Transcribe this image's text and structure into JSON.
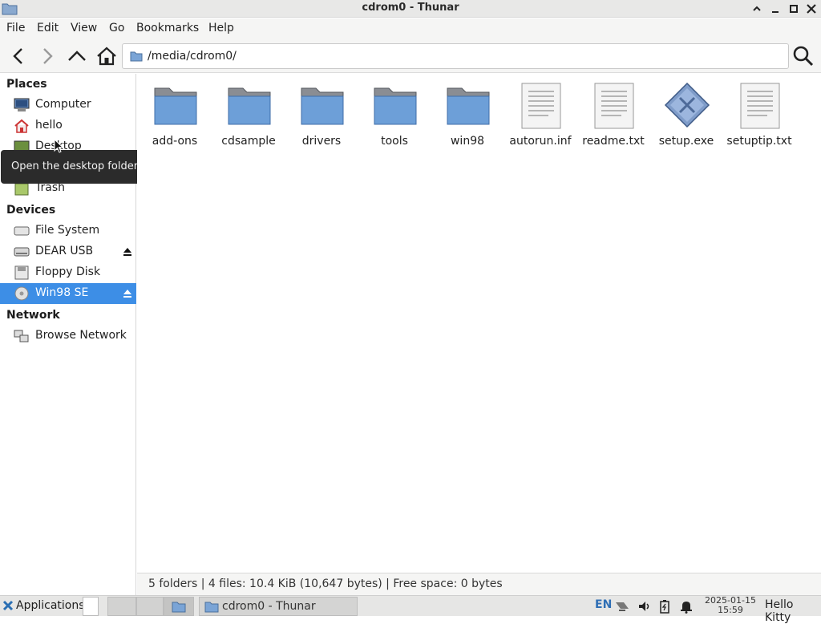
{
  "window": {
    "title": "cdrom0 - Thunar"
  },
  "menubar": {
    "items": [
      "File",
      "Edit",
      "View",
      "Go",
      "Bookmarks",
      "Help"
    ]
  },
  "toolbar": {
    "location": "/media/cdrom0/"
  },
  "sidebar": {
    "places_header": "Places",
    "places": [
      {
        "label": "Computer",
        "icon": "computer-icon"
      },
      {
        "label": "hello",
        "icon": "home-icon"
      },
      {
        "label": "Desktop",
        "icon": "desktop-icon"
      },
      {
        "label": "Trash",
        "icon": "trash-icon"
      }
    ],
    "devices_header": "Devices",
    "devices": [
      {
        "label": "File System",
        "icon": "drive-icon"
      },
      {
        "label": "DEAR USB",
        "icon": "usb-drive-icon"
      },
      {
        "label": "Floppy Disk",
        "icon": "floppy-icon"
      },
      {
        "label": "Win98 SE",
        "icon": "cdrom-icon"
      }
    ],
    "network_header": "Network",
    "network": [
      {
        "label": "Browse Network",
        "icon": "network-icon"
      }
    ]
  },
  "tooltip": "Open the desktop folder",
  "files": [
    {
      "name": "add-ons",
      "type": "folder"
    },
    {
      "name": "cdsample",
      "type": "folder"
    },
    {
      "name": "drivers",
      "type": "folder"
    },
    {
      "name": "tools",
      "type": "folder"
    },
    {
      "name": "win98",
      "type": "folder"
    },
    {
      "name": "autorun.inf",
      "type": "text"
    },
    {
      "name": "readme.txt",
      "type": "text"
    },
    {
      "name": "setup.exe",
      "type": "exe"
    },
    {
      "name": "setuptip.txt",
      "type": "text"
    }
  ],
  "statusbar": {
    "text": "5 folders  |  4 files: 10.4 KiB (10,647 bytes)  |  Free space: 0 bytes"
  },
  "taskbar": {
    "applications": "Applications",
    "window_label": "cdrom0 - Thunar",
    "lang": "EN",
    "date": "2025-01-15",
    "time": "15:59",
    "user": "Hello Kitty"
  },
  "colors": {
    "selection": "#3d8ee6",
    "folder": "#6d9fd8",
    "tooltip_bg": "#2b2b2b"
  }
}
